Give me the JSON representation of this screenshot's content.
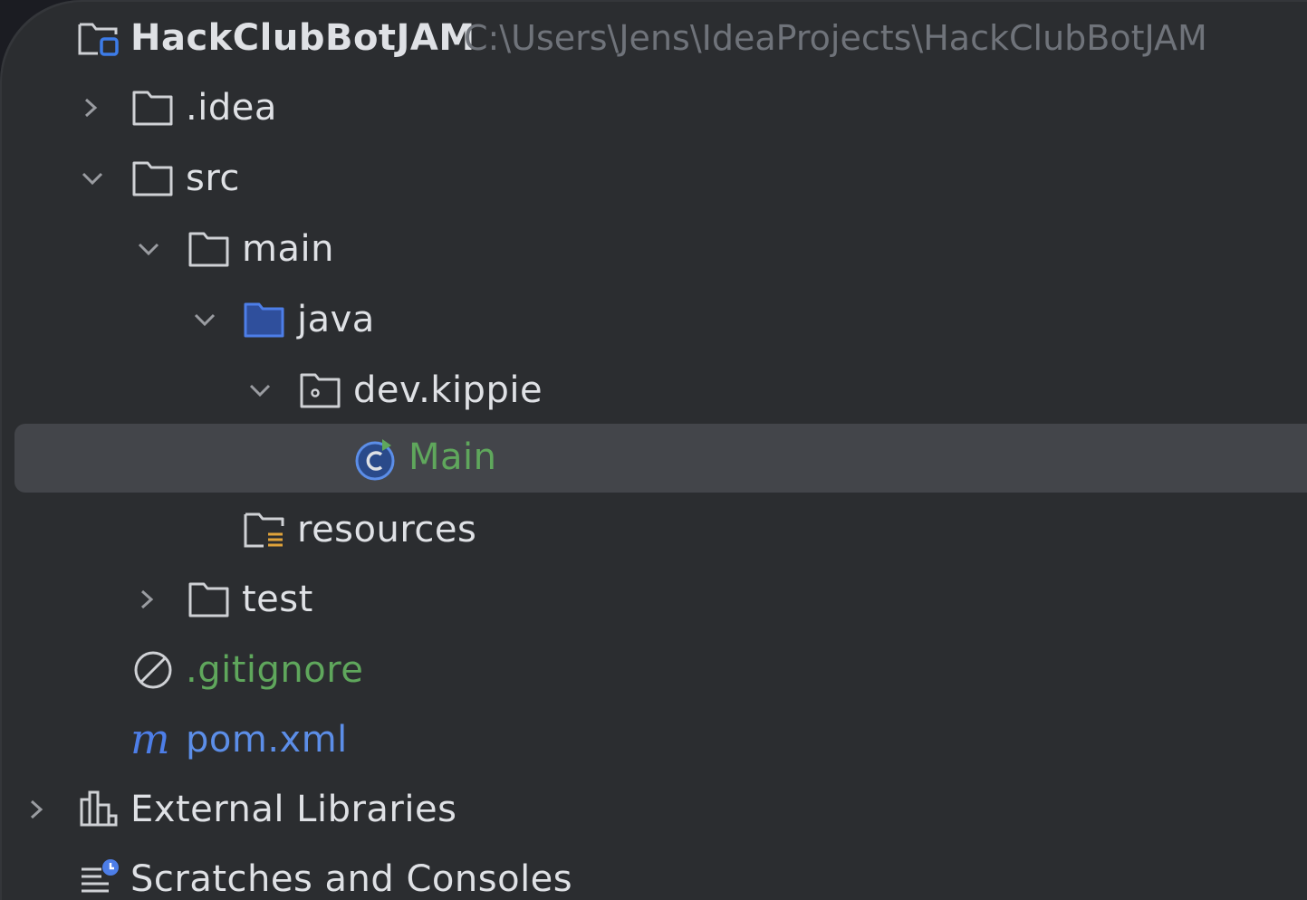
{
  "project": {
    "name": "HackClubBotJAM",
    "path": "C:\\Users\\Jens\\IdeaProjects\\HackClubBotJAM",
    "icon": "project-folder-icon"
  },
  "tree": {
    "idea": {
      "label": ".idea",
      "expanded": false,
      "icon": "folder-icon"
    },
    "src": {
      "label": "src",
      "expanded": true,
      "icon": "folder-icon"
    },
    "main": {
      "label": "main",
      "expanded": true,
      "icon": "folder-icon"
    },
    "java": {
      "label": "java",
      "expanded": true,
      "icon": "source-root-folder-icon"
    },
    "package": {
      "label": "dev.kippie",
      "expanded": true,
      "icon": "package-icon"
    },
    "main_class": {
      "label": "Main",
      "selected": true,
      "icon": "java-class-icon"
    },
    "resources": {
      "label": "resources",
      "icon": "resources-folder-icon"
    },
    "test": {
      "label": "test",
      "expanded": false,
      "icon": "folder-icon"
    },
    "gitignore": {
      "label": ".gitignore",
      "icon": "ignored-file-icon"
    },
    "pom": {
      "label": "pom.xml",
      "icon": "maven-icon"
    },
    "external_libraries": {
      "label": "External Libraries",
      "expanded": false,
      "icon": "library-icon"
    },
    "scratches": {
      "label": "Scratches and Consoles",
      "icon": "scratches-icon"
    }
  },
  "colors": {
    "background": "#2b2d30",
    "text": "#dfe1e5",
    "path": "#6f737a",
    "selected_row": "#43454a",
    "vcs_added": "#5fa75c",
    "maven_blue": "#5c8ee8"
  }
}
